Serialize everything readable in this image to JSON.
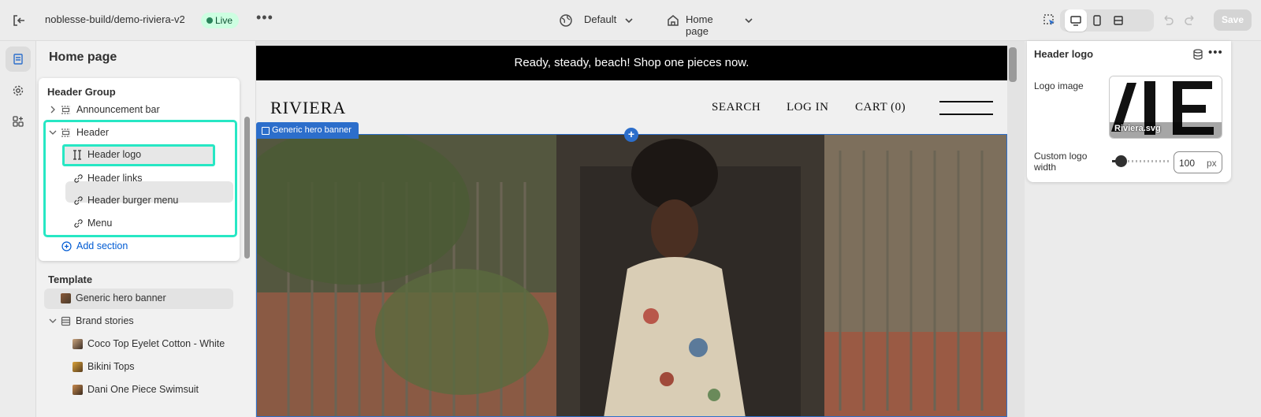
{
  "topbar": {
    "store_name": "noblesse-build/demo-riviera-v2",
    "status_badge": "Live",
    "more_label": "•••",
    "theme_selector": "Default",
    "page_selector": "Home page",
    "save_label": "Save"
  },
  "sidebar": {
    "title": "Home page",
    "header_group": {
      "label": "Header Group",
      "items": [
        {
          "label": "Announcement bar",
          "icon": "section-icon",
          "expanded": false
        },
        {
          "label": "Header",
          "icon": "section-icon",
          "expanded": true
        },
        {
          "label": "Header logo",
          "icon": "text-cursor-icon",
          "selected": true
        },
        {
          "label": "Header links",
          "icon": "link-icon"
        },
        {
          "label": "Header burger menu",
          "icon": "link-icon"
        },
        {
          "label": "Menu",
          "icon": "link-icon"
        }
      ],
      "add_section": "Add section"
    },
    "template": {
      "label": "Template",
      "items": [
        {
          "label": "Generic hero banner",
          "icon": "image-thumb"
        },
        {
          "label": "Brand stories",
          "icon": "section-icon"
        },
        {
          "label": "Coco Top Eyelet Cotton - White",
          "icon": "image-thumb"
        },
        {
          "label": "Bikini Tops",
          "icon": "image-thumb"
        },
        {
          "label": "Dani One Piece Swimsuit",
          "icon": "image-thumb"
        }
      ]
    }
  },
  "preview": {
    "announcement": "Ready, steady, beach! Shop one pieces now.",
    "logo_text": "RIVIERA",
    "nav": [
      "SEARCH",
      "LOG IN",
      "CART (0)"
    ],
    "hero_label": "Generic hero banner",
    "plus_label": "+"
  },
  "inspector": {
    "title": "Header logo",
    "more_label": "•••",
    "logo_image_label": "Logo image",
    "logo_image_file": "Riviera.svg",
    "logo_width_label": "Custom logo width",
    "logo_width_value": "100",
    "logo_width_unit": "px",
    "logo_width_fraction": 0.15
  },
  "colors": {
    "live_bg": "#cdfee1",
    "live_dot": "#29845a",
    "highlight": "#27e7c4",
    "selection_blue": "#2c6ecb",
    "link_blue": "#005bd3"
  }
}
